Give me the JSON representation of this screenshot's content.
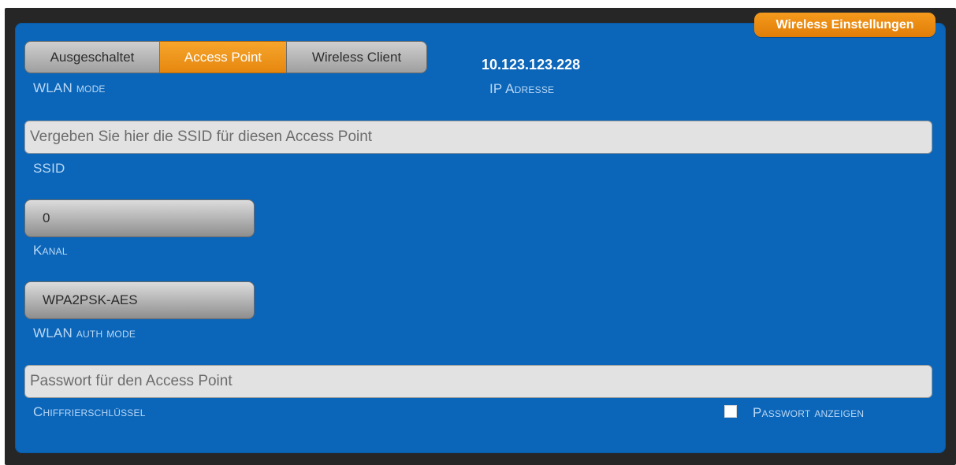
{
  "badge": {
    "title": "Wireless Einstellungen",
    "color": "#e58308"
  },
  "wlan_mode": {
    "options": [
      "Ausgeschaltet",
      "Access Point",
      "Wireless Client"
    ],
    "selected": "Access Point",
    "label": "WLAN mode"
  },
  "ip": {
    "value": "10.123.123.228",
    "label": "IP Adresse"
  },
  "ssid": {
    "value": "",
    "placeholder": "Vergeben Sie hier die SSID für diesen Access Point",
    "label": "SSID"
  },
  "kanal": {
    "value": "0",
    "label": "Kanal"
  },
  "auth_mode": {
    "value": "WPA2PSK-AES",
    "label": "WLAN auth mode"
  },
  "key": {
    "value": "",
    "placeholder": "Passwort für den Access Point",
    "label": "Chiffrierschlüssel"
  },
  "show_password": {
    "label": "Passwort anzeigen",
    "checked": false
  },
  "colors": {
    "panel": "#0b65b8",
    "accent": "#e58308",
    "label": "#b9d8f6"
  }
}
